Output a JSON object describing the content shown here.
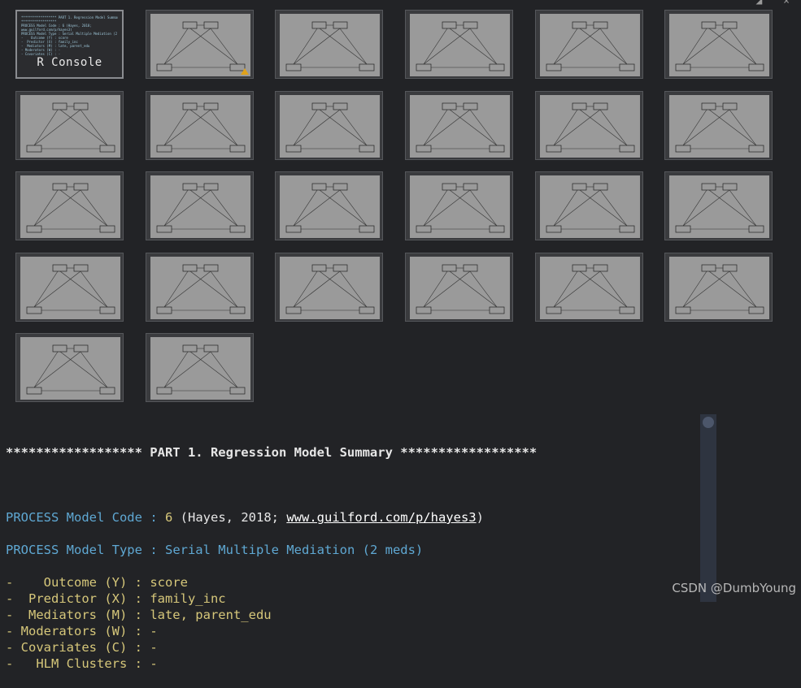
{
  "console_thumb": {
    "label": "R Console",
    "preview_lines": [
      "****************** PART 1. Regression Model Summary",
      "******************",
      "PROCESS Model Code : 6 (Hayes, 2018;",
      "www.guilford.com/p/hayes3)",
      "PROCESS Model Type : Serial Multiple Mediation (2 meds)",
      "-    Outcome (Y) : score",
      "-  Predictor (X) : family_inc",
      "-  Mediators (M) : late, parent_edu",
      "- Moderators (W) : -",
      "- Covariates (C) : -"
    ]
  },
  "plot_thumbs": {
    "count": 25,
    "plot_title": "Serial Multiple Mediation"
  },
  "output": {
    "header": "****************** PART 1. Regression Model Summary ******************",
    "model_code_label": "PROCESS Model Code",
    "model_code_value": "6",
    "model_code_ref_pre": "(Hayes, 2018; ",
    "model_code_link": "www.guilford.com/p/hayes3",
    "model_code_ref_post": ")",
    "model_type_label": "PROCESS Model Type",
    "model_type_value": "Serial Multiple Mediation (2 meds)",
    "rows": [
      {
        "label": "-    Outcome (Y)",
        "value": "score"
      },
      {
        "label": "-  Predictor (X)",
        "value": "family_inc"
      },
      {
        "label": "-  Mediators (M)",
        "value": "late, parent_edu"
      },
      {
        "label": "- Moderators (W)",
        "value": "-"
      },
      {
        "label": "- Covariates (C)",
        "value": "-"
      },
      {
        "label": "-   HLM Clusters",
        "value": "-"
      }
    ]
  },
  "watermark": "CSDN @DumbYoung",
  "colors": {
    "background": "#222326",
    "plot_bg": "#9a9a9a",
    "warning": "#e0a21a"
  }
}
